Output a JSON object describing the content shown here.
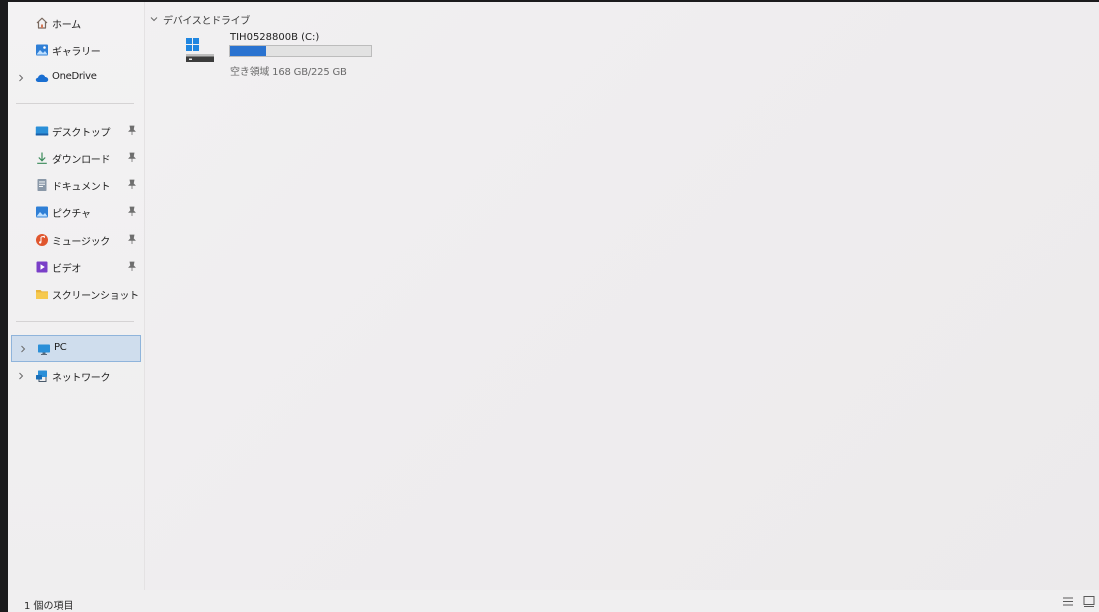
{
  "sidebar": {
    "quick": [
      {
        "label": "ホーム",
        "icon": "home-icon"
      },
      {
        "label": "ギャラリー",
        "icon": "gallery-icon"
      },
      {
        "label": "OneDrive",
        "icon": "onedrive-cloud-icon"
      }
    ],
    "pinned": [
      {
        "label": "デスクトップ",
        "icon": "desktop-icon"
      },
      {
        "label": "ダウンロード",
        "icon": "download-icon"
      },
      {
        "label": "ドキュメント",
        "icon": "document-icon"
      },
      {
        "label": "ピクチャ",
        "icon": "pictures-icon"
      },
      {
        "label": "ミュージック",
        "icon": "music-icon"
      },
      {
        "label": "ビデオ",
        "icon": "video-icon"
      },
      {
        "label": "スクリーンショット",
        "icon": "folder-icon"
      }
    ],
    "devices": [
      {
        "label": "PC",
        "icon": "pc-monitor-icon",
        "selected": true
      },
      {
        "label": "ネットワーク",
        "icon": "network-icon"
      }
    ]
  },
  "content": {
    "group_header": "デバイスとドライブ",
    "drive": {
      "name": "TIH0528800B (C:)",
      "free_text": "空き領域 168 GB/225 GB",
      "used_fraction": 0.253,
      "bar_color": "#2a73d0"
    }
  },
  "status": {
    "item_count": "1 個の項目"
  },
  "colors": {
    "accent": "#2a73d0",
    "selection_bg": "#cfdded",
    "selection_border": "#8fb4db"
  }
}
